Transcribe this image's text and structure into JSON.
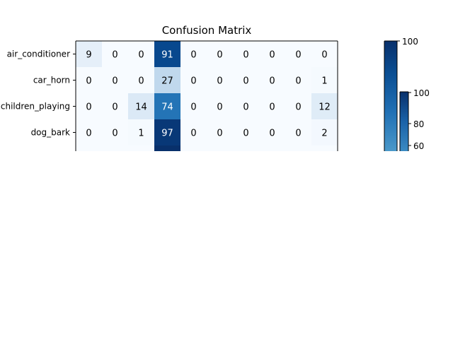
{
  "chart_data": {
    "type": "heatmap",
    "title": "Confusion Matrix",
    "row_labels": [
      "air_conditioner",
      "car_horn",
      "children_playing",
      "dog_bark"
    ],
    "matrix": [
      [
        9,
        0,
        0,
        91,
        0,
        0,
        0,
        0,
        0,
        0
      ],
      [
        0,
        0,
        0,
        27,
        0,
        0,
        0,
        0,
        0,
        1
      ],
      [
        0,
        0,
        14,
        74,
        0,
        0,
        0,
        0,
        0,
        12
      ],
      [
        0,
        0,
        1,
        97,
        0,
        0,
        0,
        0,
        0,
        2
      ]
    ],
    "colormap": "Blues",
    "colorbar_main": {
      "visible_ticks": [
        "100"
      ]
    },
    "colorbar_small": {
      "visible_ticks": [
        "100",
        "80",
        "60"
      ]
    },
    "colors": {
      "text_light": "#ffffff",
      "text_dark": "#000000"
    }
  }
}
